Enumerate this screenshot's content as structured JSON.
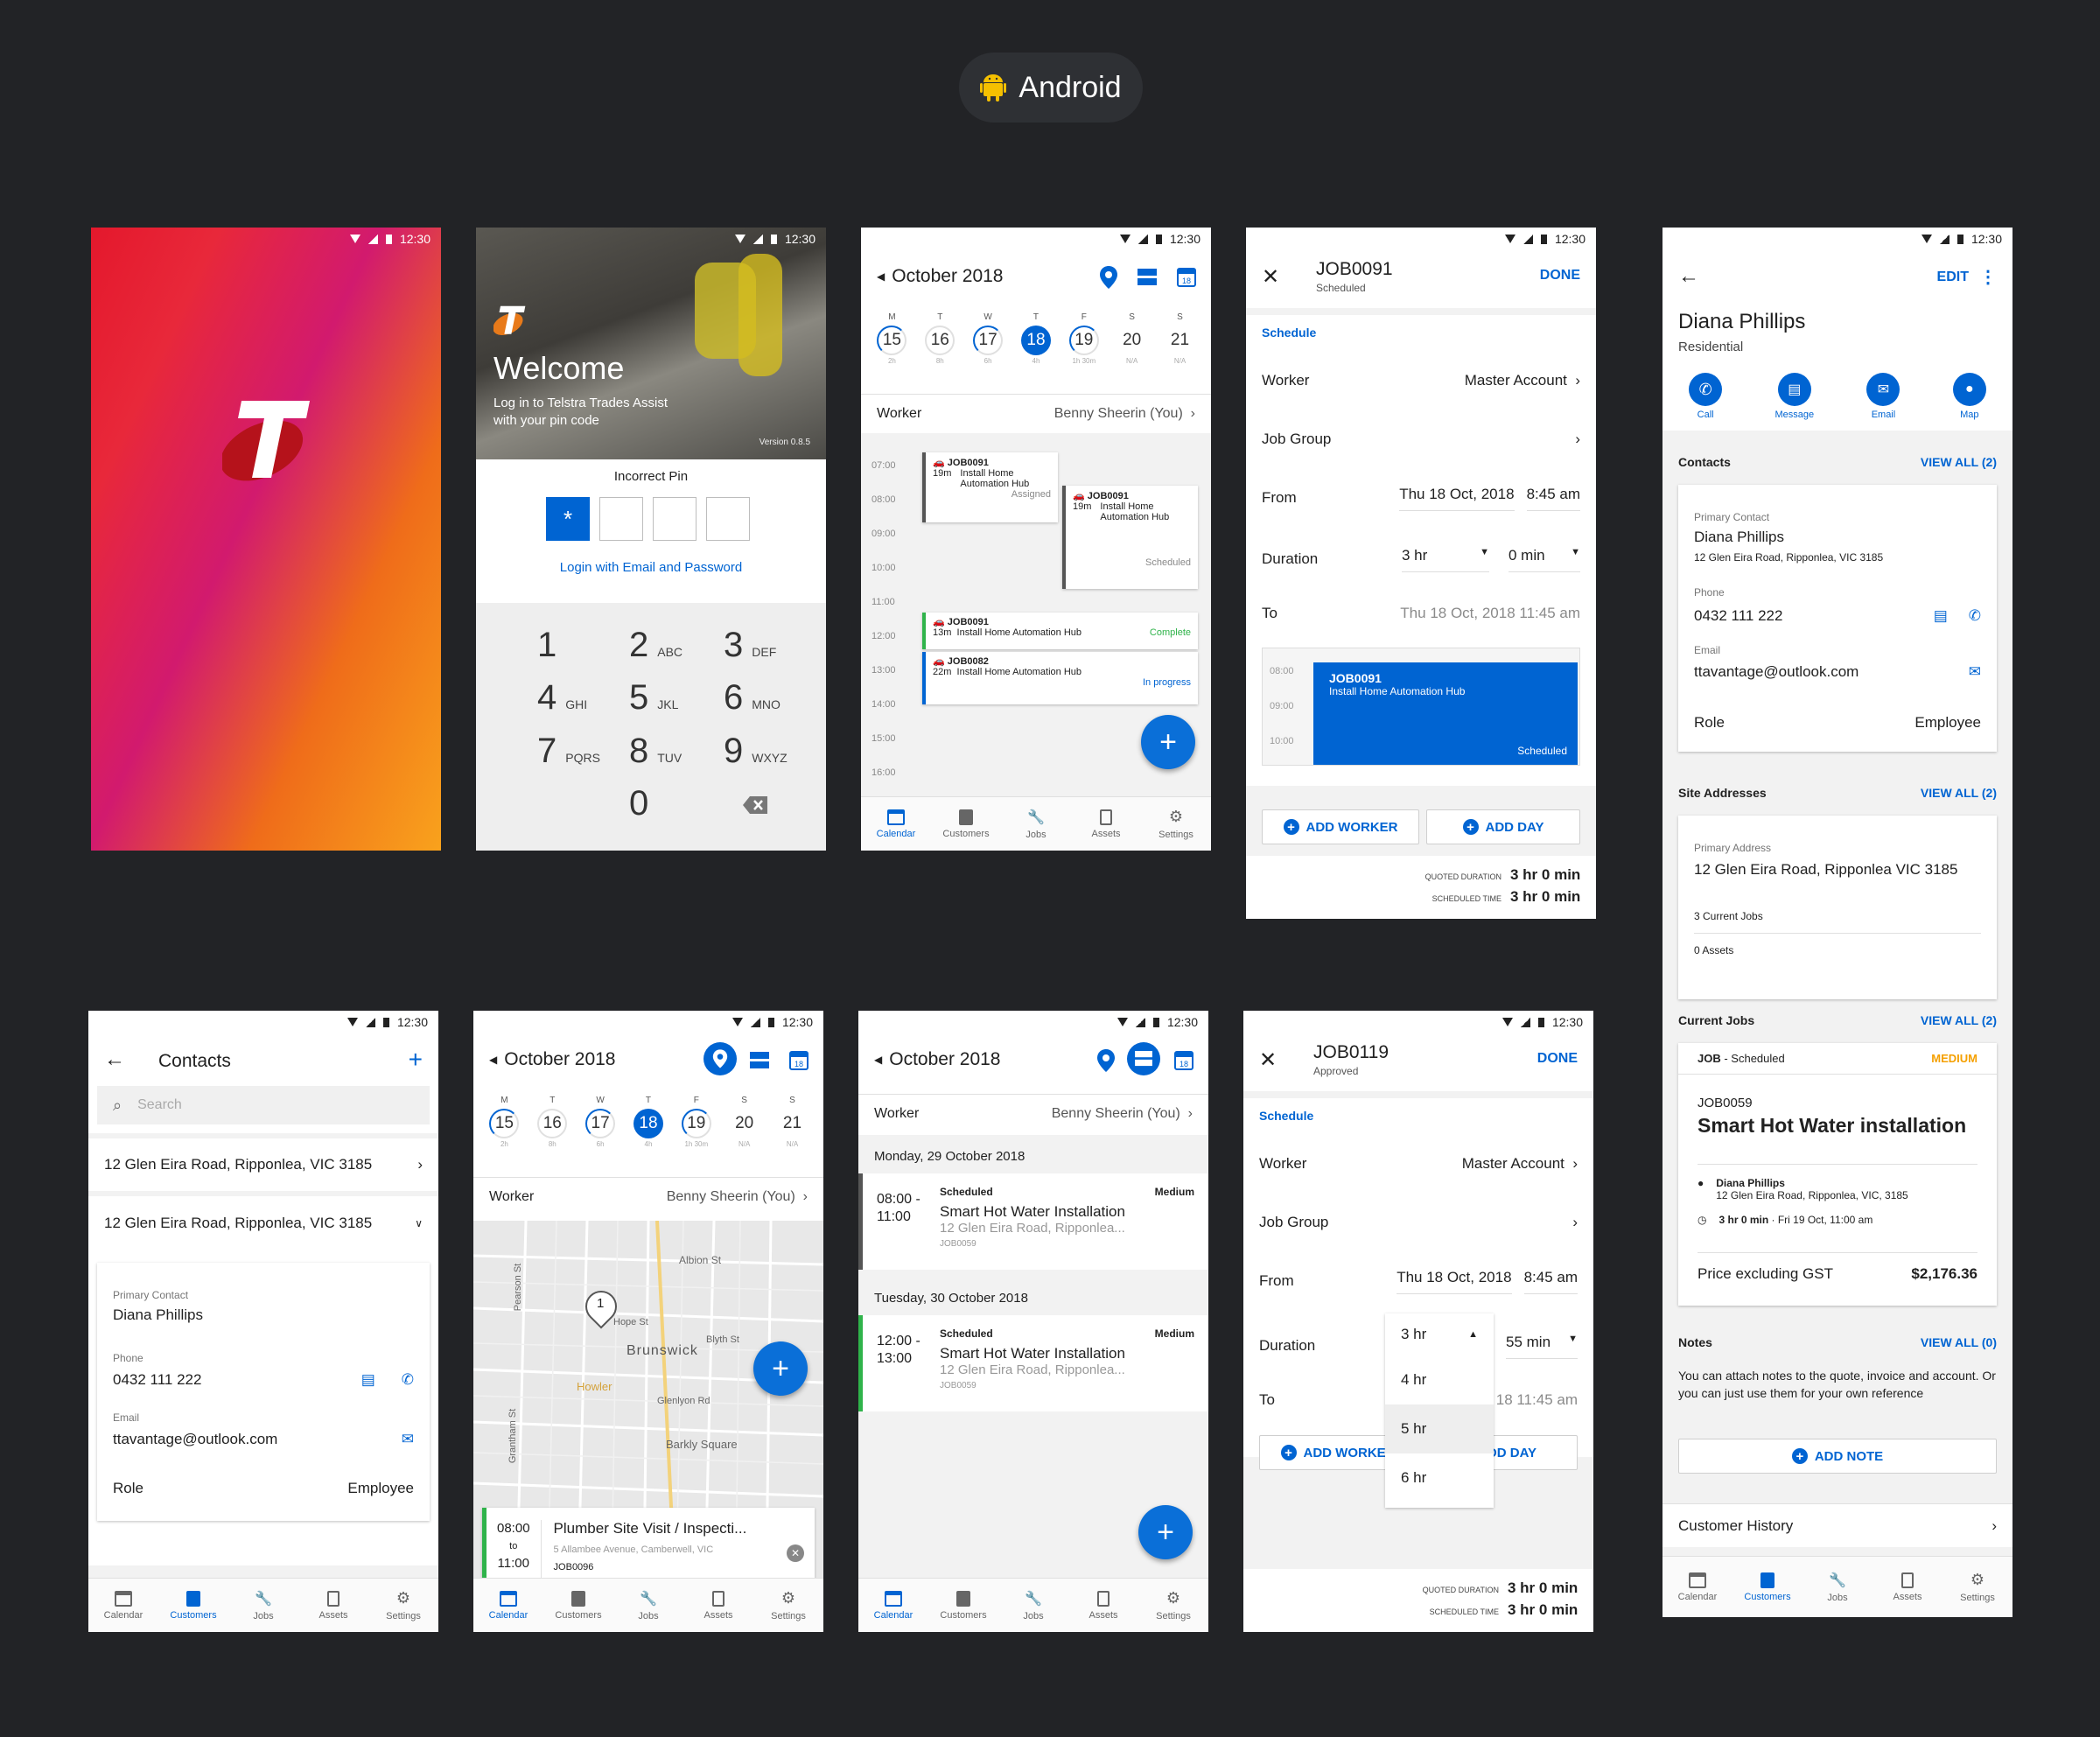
{
  "header": {
    "platform": "Android"
  },
  "status": {
    "time": "12:30"
  },
  "splash": {
    "logo": "T"
  },
  "login": {
    "welcome": "Welcome",
    "subtitle1": "Log in to Telstra Trades Assist",
    "subtitle2": "with your pin code",
    "version": "Version 0.8.5",
    "error": "Incorrect Pin",
    "pin1": "*",
    "link": "Login with Email and Password",
    "keys": [
      {
        "n": "1",
        "l": ""
      },
      {
        "n": "2",
        "l": "ABC"
      },
      {
        "n": "3",
        "l": "DEF"
      },
      {
        "n": "4",
        "l": "GHI"
      },
      {
        "n": "5",
        "l": "JKL"
      },
      {
        "n": "6",
        "l": "MNO"
      },
      {
        "n": "7",
        "l": "PQRS"
      },
      {
        "n": "8",
        "l": "TUV"
      },
      {
        "n": "9",
        "l": "WXYZ"
      },
      {
        "n": "0",
        "l": ""
      }
    ]
  },
  "calendar": {
    "month": "October 2018",
    "worker_label": "Worker",
    "worker_value": "Benny Sheerin (You)",
    "days": [
      {
        "d": "M",
        "n": "15",
        "s": "2h"
      },
      {
        "d": "T",
        "n": "16",
        "s": "8h"
      },
      {
        "d": "W",
        "n": "17",
        "s": "6h"
      },
      {
        "d": "T",
        "n": "18",
        "s": "4h"
      },
      {
        "d": "F",
        "n": "19",
        "s": "1h 30m"
      },
      {
        "d": "S",
        "n": "20",
        "s": "N/A"
      },
      {
        "d": "S",
        "n": "21",
        "s": "N/A"
      }
    ],
    "hours": [
      "07:00",
      "08:00",
      "09:00",
      "10:00",
      "11:00",
      "12:00",
      "13:00",
      "14:00",
      "15:00",
      "16:00"
    ],
    "ev1": {
      "id": "JOB0091",
      "dur": "19m",
      "title1": "Install Home",
      "title2": "Automation Hub",
      "status": "Assigned"
    },
    "ev2": {
      "id": "JOB0091",
      "dur": "19m",
      "title1": "Install Home",
      "title2": "Automation Hub",
      "status": "Scheduled"
    },
    "ev3": {
      "id": "JOB0091",
      "dur": "13m",
      "title": "Install Home Automation Hub",
      "status": "Complete"
    },
    "ev4": {
      "id": "JOB0082",
      "dur": "22m",
      "title": "Install Home Automation Hub",
      "status": "In progress"
    }
  },
  "nav": [
    "Calendar",
    "Customers",
    "Jobs",
    "Assets",
    "Settings"
  ],
  "job1": {
    "id": "JOB0091",
    "status": "Scheduled",
    "done": "DONE",
    "section": "Schedule",
    "worker_label": "Worker",
    "worker": "Master Account",
    "group_label": "Job Group",
    "from_label": "From",
    "from_date": "Thu 18 Oct, 2018",
    "from_time": "8:45 am",
    "dur_label": "Duration",
    "dur_h": "3 hr",
    "dur_m": "0 min",
    "to_label": "To",
    "to_value": "Thu 18 Oct, 2018 11:45 am",
    "mini_hours": [
      "08:00",
      "09:00",
      "10:00"
    ],
    "block_id": "JOB0091",
    "block_title": "Install Home Automation Hub",
    "block_status": "Scheduled",
    "add_worker": "ADD WORKER",
    "add_day": "ADD DAY",
    "quoted_label": "QUOTED DURATION",
    "quoted": "3 hr 0 min",
    "sched_label": "SCHEDULED TIME",
    "sched": "3 hr 0 min"
  },
  "customer": {
    "edit": "EDIT",
    "name": "Diana Phillips",
    "type": "Residential",
    "actions": [
      "Call",
      "Message",
      "Email",
      "Map"
    ],
    "contacts_title": "Contacts",
    "view_all_2": "VIEW ALL (2)",
    "primary_label": "Primary Contact",
    "contact_name": "Diana Phillips",
    "contact_addr": "12 Glen Eira Road, Ripponlea, VIC 3185",
    "phone_label": "Phone",
    "phone": "0432 111 222",
    "email_label": "Email",
    "email": "ttavantage@outlook.com",
    "role_label": "Role",
    "role": "Employee",
    "sites_title": "Site Addresses",
    "primary_addr_label": "Primary Address",
    "primary_addr": "12 Glen Eira Road, Ripponlea VIC 3185",
    "current_jobs": "3 Current Jobs",
    "assets": "0 Assets",
    "jobs_title": "Current Jobs",
    "job_tag": "JOB",
    "job_tag_status": " - Scheduled",
    "priority": "MEDIUM",
    "job_id": "JOB0059",
    "job_title": "Smart Hot Water installation",
    "job_person": "Diana Phillips",
    "job_addr": "12 Glen Eira Road, Ripponlea, VIC, 3185",
    "job_time_bold": "3 hr 0 min",
    "job_time": " · Fri 19 Oct, 11:00 am",
    "price_label": "Price excluding GST",
    "price": "$2,176.36",
    "notes_title": "Notes",
    "view_all_0": "VIEW ALL (0)",
    "notes_text": "You can attach notes to the quote, invoice and account. Or you can just use them for your own reference",
    "add_note": "ADD NOTE",
    "history": "Customer History"
  },
  "contacts": {
    "title": "Contacts",
    "search": "Search",
    "addr1": "12 Glen Eira Road, Ripponlea, VIC 3185",
    "addr2": "12 Glen Eira Road, Ripponlea, VIC 3185",
    "primary_label": "Primary Contact",
    "name": "Diana Phillips",
    "phone_label": "Phone",
    "phone": "0432 111 222",
    "email_label": "Email",
    "email": "ttavantage@outlook.com",
    "role_label": "Role",
    "role": "Employee"
  },
  "map": {
    "marker": "1",
    "streets": [
      "Albion St",
      "Hope St",
      "Brunswick",
      "Blyth St",
      "Glenlyon Rd",
      "Barkly Square",
      "Pearson St",
      "Grantham St",
      "Howler"
    ],
    "corner1": "Br",
    "card": {
      "time_from": "08:00",
      "to": "to",
      "time_to": "11:00",
      "title": "Plumber Site Visit / Inspecti...",
      "addr": "5 Allambee Avenue, Camberwell, VIC",
      "id": "JOB0096"
    }
  },
  "list": {
    "day1": "Monday, 29 October 2018",
    "day2": "Tuesday, 30 October 2018",
    "item1": {
      "t1": "08:00 -",
      "t2": "11:00",
      "status": "Scheduled",
      "priority": "Medium",
      "title": "Smart Hot Water Installation",
      "addr": "12 Glen Eira Road, Ripponlea...",
      "id": "JOB0059"
    },
    "item2": {
      "t1": "12:00 -",
      "t2": "13:00",
      "status": "Scheduled",
      "priority": "Medium",
      "title": "Smart Hot Water Installation",
      "addr": "12 Glen Eira Road, Ripponlea...",
      "id": "JOB0059"
    }
  },
  "job2": {
    "id": "JOB0119",
    "status": "Approved",
    "done": "DONE",
    "section": "Schedule",
    "worker_label": "Worker",
    "worker": "Master Account",
    "group_label": "Job Group",
    "from_label": "From",
    "from_date": "Thu 18 Oct, 2018",
    "from_time": "8:45 am",
    "dur_label": "Duration",
    "dur_h": "3 hr",
    "dur_m": "55 min",
    "to_label": "To",
    "to_value": "18 11:45 am",
    "options": [
      "4 hr",
      "5 hr",
      "6 hr"
    ],
    "add_worker": "ADD WORKER",
    "add_day": "DD DAY",
    "quoted_label": "QUOTED DURATION",
    "quoted": "3 hr 0 min",
    "sched_label": "SCHEDULED TIME",
    "sched": "3 hr 0 min"
  }
}
